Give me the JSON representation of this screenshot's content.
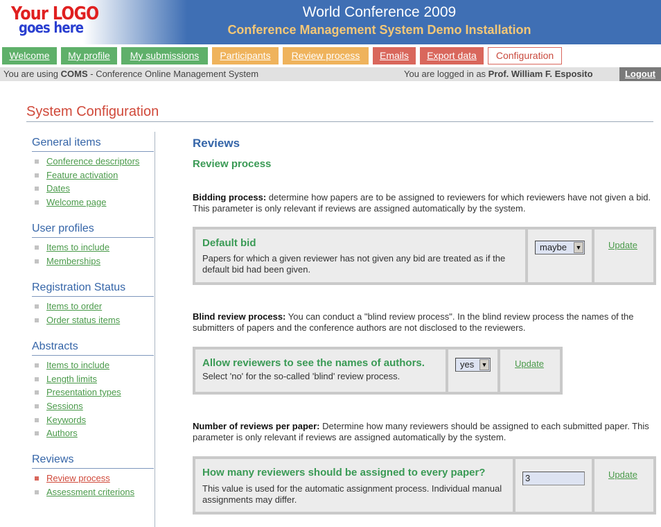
{
  "header": {
    "logo_line1": "Your LOGO",
    "logo_line2": "goes here",
    "title": "World Conference 2009",
    "subtitle": "Conference Management System Demo Installation"
  },
  "tabs": [
    {
      "label": "Welcome",
      "color": "#5fb06a"
    },
    {
      "label": "My profile",
      "color": "#5fb06a"
    },
    {
      "label": "My submissions",
      "color": "#5fb06a"
    },
    {
      "label": "Participants",
      "color": "#efb35c"
    },
    {
      "label": "Review process",
      "color": "#efb35c"
    },
    {
      "label": "Emails",
      "color": "#d9675c"
    },
    {
      "label": "Export data",
      "color": "#d9675c"
    },
    {
      "label": "Configuration",
      "color": "#ffffff",
      "active": true
    }
  ],
  "status": {
    "using_prefix": "You are using ",
    "app_short": "COMS",
    "app_suffix": " - Conference Online Management System",
    "logged_prefix": "You are logged in as ",
    "user_name": "Prof. William F. Esposito",
    "logout_label": "Logout"
  },
  "page_title": "System Configuration",
  "sidebar": {
    "sections": [
      {
        "heading": "General items",
        "items": [
          "Conference descriptors",
          "Feature activation",
          "Dates",
          "Welcome page"
        ]
      },
      {
        "heading": "User profiles",
        "items": [
          "Items to include",
          "Memberships"
        ]
      },
      {
        "heading": "Registration Status",
        "items": [
          "Items to order",
          "Order status items"
        ]
      },
      {
        "heading": "Abstracts",
        "items": [
          "Items to include",
          "Length limits",
          "Presentation types",
          "Sessions",
          "Keywords",
          "Authors"
        ]
      },
      {
        "heading": "Reviews",
        "items": [
          "Review process",
          "Assessment criterions"
        ],
        "current": "Review process"
      }
    ]
  },
  "main": {
    "heading": "Reviews",
    "subheading": "Review process",
    "bidding": {
      "label": "Bidding process:",
      "text": " determine how papers are to be assigned to reviewers for which reviewers have not given a bid. This parameter is only relevant if reviews are assigned automatically by the system.",
      "setting_title": "Default bid",
      "setting_desc": "Papers for which a given reviewer has not given any bid are treated as if the default bid had been given.",
      "value": "maybe",
      "update_label": "Update"
    },
    "blind": {
      "label": "Blind review process:",
      "text": " You can conduct a \"blind review process\". In the blind review process the names of the submitters of papers and the conference authors are not disclosed to the reviewers.",
      "setting_title": "Allow reviewers to see the names of authors.",
      "setting_desc": "Select 'no' for the so-called 'blind' review process.",
      "value": "yes",
      "update_label": "Update"
    },
    "count": {
      "label": "Number of reviews per paper:",
      "text": " Determine how many reviewers should be assigned to each submitted paper. This parameter is only relevant if reviews are assigned automatically by the system.",
      "setting_title": "How many reviewers should be assigned to every paper?",
      "setting_desc": "This value is used for the automatic assignment process. Individual manual assignments may differ.",
      "value": "3",
      "update_label": "Update"
    }
  }
}
